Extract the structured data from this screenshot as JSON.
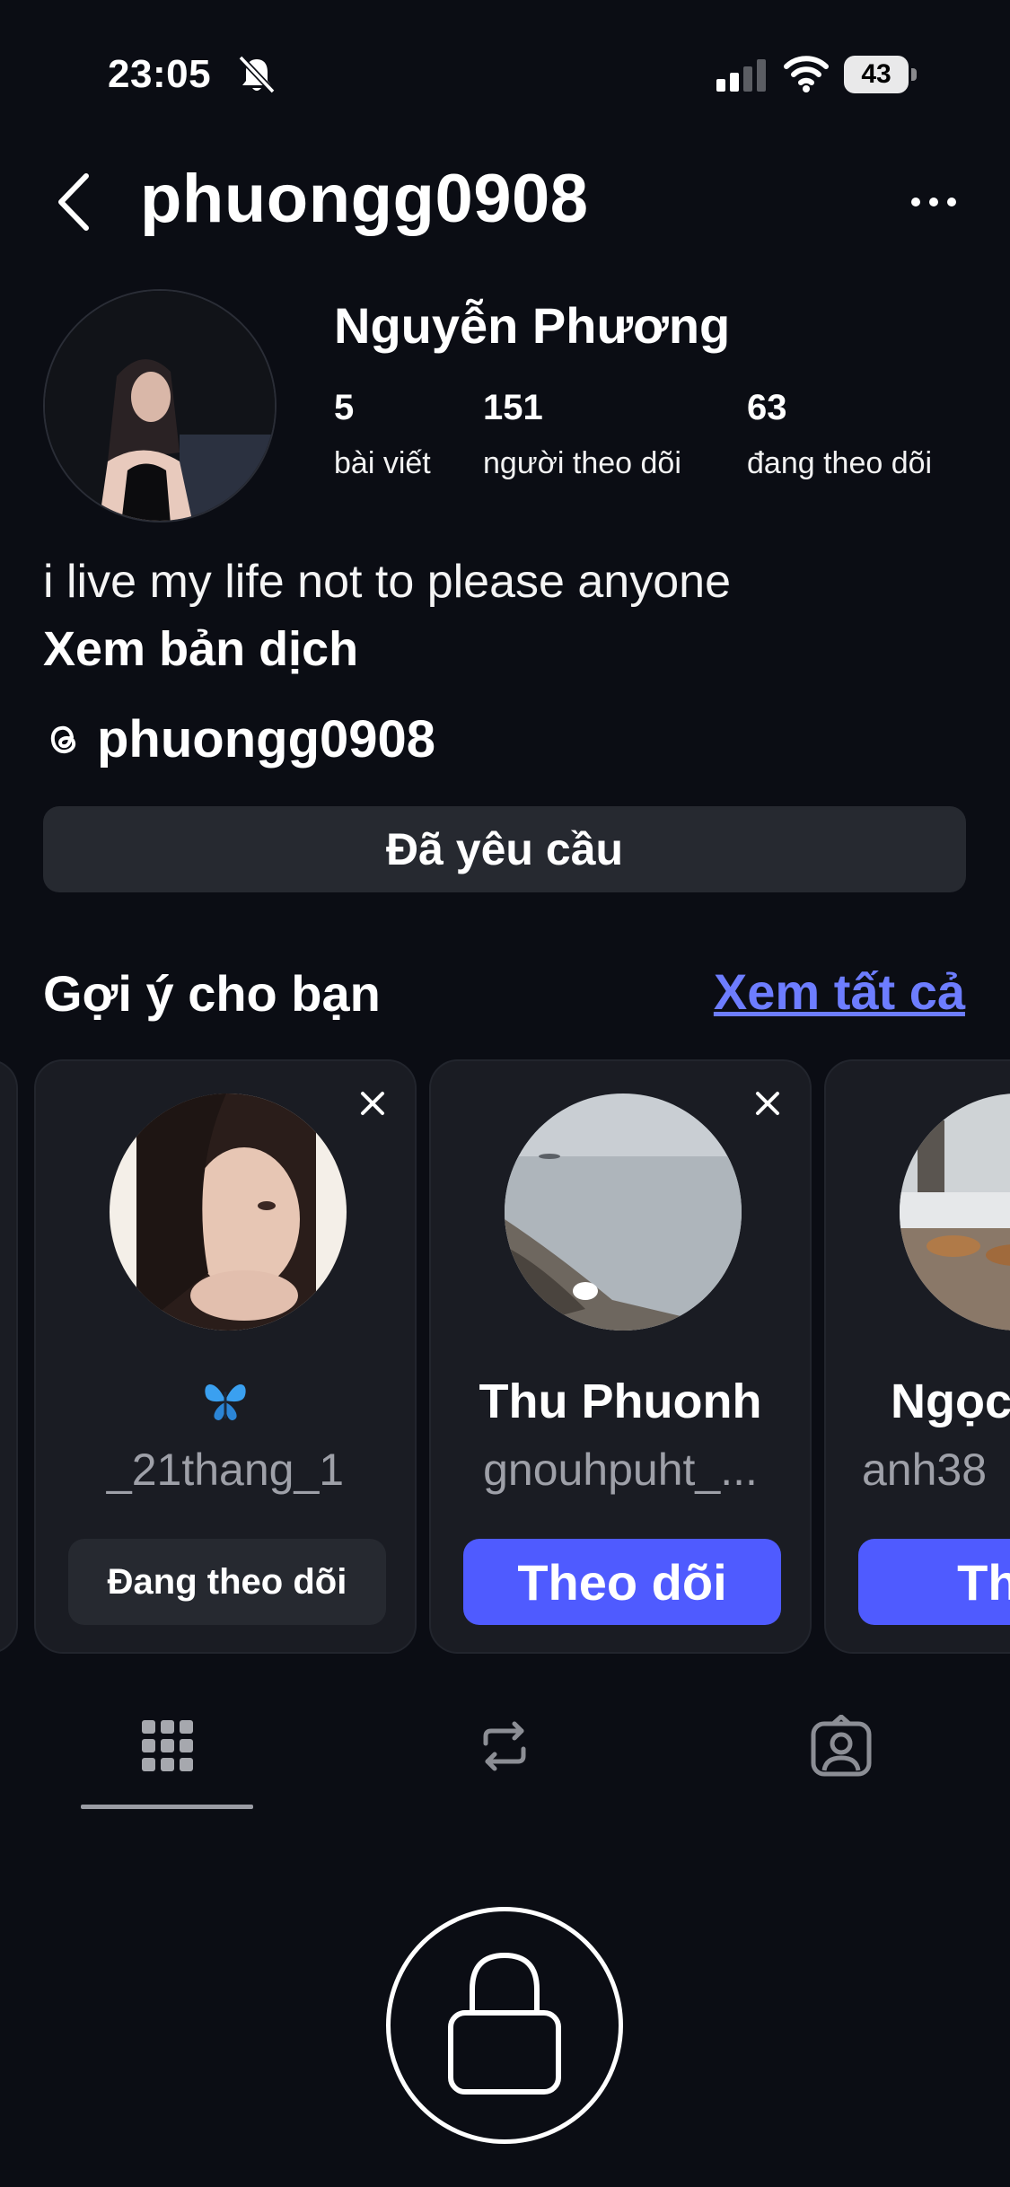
{
  "status_bar": {
    "time": "23:05",
    "battery": "43",
    "battery_level": 0.43
  },
  "header": {
    "username": "phuongg0908"
  },
  "profile": {
    "display_name": "Nguyễn Phương",
    "stats": [
      {
        "value": "5",
        "label": "bài viết"
      },
      {
        "value": "151",
        "label": "người theo dõi"
      },
      {
        "value": "63",
        "label": "đang theo dõi"
      }
    ],
    "bio": "i live my life not to please anyone",
    "translate_label": "Xem bản dịch",
    "threads_handle": "phuongg0908",
    "requested_label": "Đã yêu cầu"
  },
  "suggestions": {
    "title": "Gợi ý cho bạn",
    "see_all": "Xem tất cả",
    "cards": [
      {
        "name": "",
        "username": "_21thang_1",
        "button": "Đang theo dõi"
      },
      {
        "name": "Thu Phuonh",
        "username": "gnouhpuht_...",
        "button": "Theo dõi"
      },
      {
        "name": "Ngọc",
        "username": "anh38",
        "button": "Theo"
      }
    ]
  },
  "tabs": [
    "grid-icon",
    "reposts-icon",
    "tagged-icon"
  ],
  "colors": {
    "background": "#0b0d14",
    "accent": "#4f5bff",
    "link": "#6d7dff",
    "surface": "#262930"
  }
}
